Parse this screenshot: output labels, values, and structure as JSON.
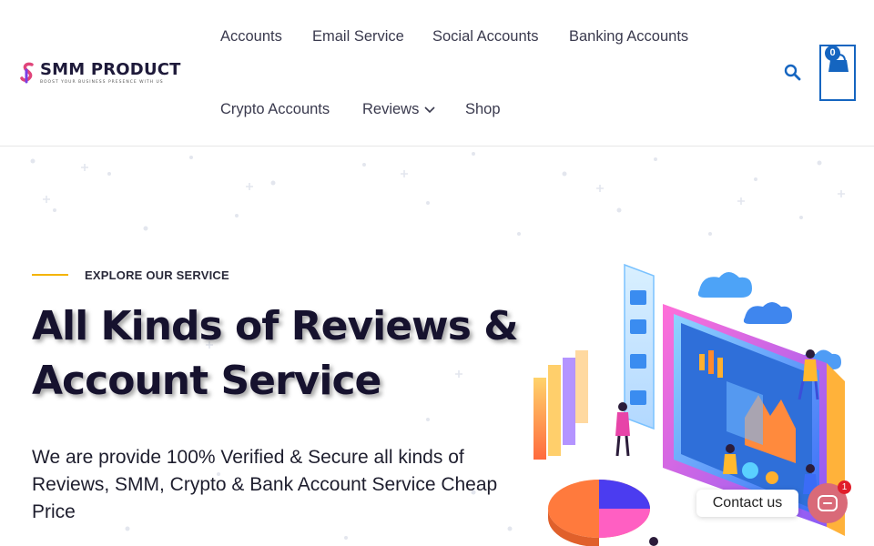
{
  "brand": {
    "name": "SMM PRODUCT",
    "tagline": "BOOST YOUR BUSINESS PRESENCE WITH US"
  },
  "nav": {
    "items": [
      {
        "label": "Accounts"
      },
      {
        "label": "Email Service"
      },
      {
        "label": "Social Accounts"
      },
      {
        "label": "Banking Accounts"
      },
      {
        "label": "Crypto Accounts"
      },
      {
        "label": "Reviews"
      },
      {
        "label": "Shop"
      }
    ]
  },
  "cart": {
    "count": "0"
  },
  "hero": {
    "eyebrow": "EXPLORE OUR SERVICE",
    "title_line1": "All Kinds of Reviews &",
    "title_line2": "Account Service",
    "subtitle": "We are provide 100% Verified & Secure all kinds of Reviews, SMM, Crypto & Bank Account Service Cheap Price"
  },
  "contact": {
    "label": "Contact us",
    "badge": "1"
  },
  "colors": {
    "accent_blue": "#1565c0",
    "eyebrow_line": "#f4b400",
    "contact_button": "#d96a78",
    "badge_red": "#e11d2a"
  },
  "icons": [
    "search-icon",
    "cart-icon",
    "chevron-down-icon",
    "chat-icon",
    "logo-icon"
  ]
}
